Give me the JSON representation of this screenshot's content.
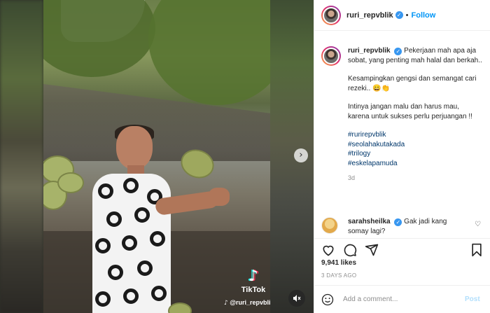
{
  "header": {
    "username": "ruri_repvblik",
    "verified": true,
    "separator": "•",
    "follow_label": "Follow"
  },
  "caption": {
    "username": "ruri_repvblik",
    "lines": [
      "Pekerjaan mah apa aja sobat, yang penting mah halal dan berkah..",
      "Kesampingkan gengsi dan semangat cari rezeki.. 😄👏",
      "Intinya jangan malu dan harus mau, karena untuk sukses perlu perjuangan !!"
    ],
    "hashtags": [
      "#rurirepvblik",
      "#seolahakutakada",
      "#trilogy",
      "#eskelapamuda"
    ],
    "time": "3d"
  },
  "reply": {
    "username": "sarahsheilka",
    "text": "Gak jadi kang somay lagi?"
  },
  "media": {
    "watermark_brand": "TikTok",
    "watermark_handle": "@ruri_repvblik",
    "next_icon": "chevron-right-icon",
    "mute_icon": "speaker-muted-icon"
  },
  "stats": {
    "likes": "9,941 likes",
    "date": "3 DAYS AGO"
  },
  "composer": {
    "placeholder": "Add a comment...",
    "post_label": "Post"
  },
  "colors": {
    "link_blue": "#0095f6",
    "verified_blue": "#3897f0",
    "hashtag": "#00376b",
    "muted_text": "#8e8e8e",
    "post_disabled": "#b2dffc"
  }
}
